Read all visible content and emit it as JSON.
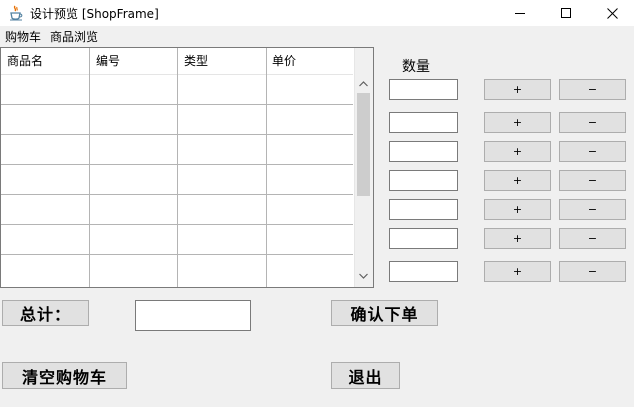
{
  "window": {
    "title": "设计预览 [ShopFrame]",
    "icon": "java-cup-icon",
    "controls": {
      "minimize": "—",
      "maximize": "☐",
      "close": "✕"
    }
  },
  "menubar": {
    "items": [
      "购物车",
      "商品浏览"
    ]
  },
  "table": {
    "columns": [
      "商品名",
      "编号",
      "类型",
      "单价"
    ],
    "rows": [
      [
        "",
        "",
        "",
        ""
      ],
      [
        "",
        "",
        "",
        ""
      ],
      [
        "",
        "",
        "",
        ""
      ],
      [
        "",
        "",
        "",
        ""
      ],
      [
        "",
        "",
        "",
        ""
      ],
      [
        "",
        "",
        "",
        ""
      ],
      [
        "",
        "",
        "",
        ""
      ]
    ],
    "scroll_up": "˄",
    "scroll_down": "˅"
  },
  "quantity": {
    "label": "数量",
    "values": [
      "",
      "",
      "",
      "",
      "",
      "",
      ""
    ],
    "plus_label": "+",
    "minus_label": "−"
  },
  "footer": {
    "total_label": "总计：",
    "total_value": "",
    "confirm_label": "确认下单",
    "clear_label": "清空购物车",
    "exit_label": "退出"
  },
  "colors": {
    "window_bg": "#f0f0f0",
    "titlebar_bg": "#ffffff",
    "button_bg": "#e1e1e1",
    "button_border": "#adadad",
    "grid_line": "#b4b4b4"
  }
}
